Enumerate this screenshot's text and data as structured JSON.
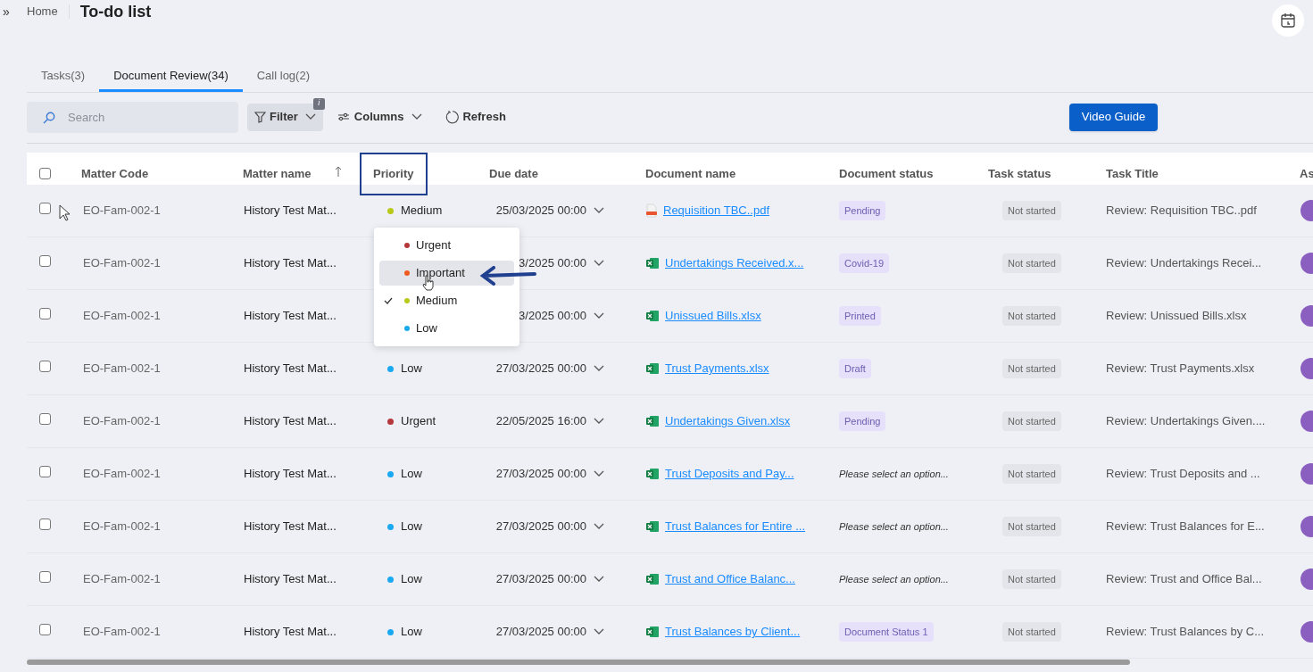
{
  "breadcrumb": {
    "home": "Home",
    "title": "To-do list",
    "expand": "»"
  },
  "tabs": [
    {
      "label": "Tasks(3)",
      "selected": false
    },
    {
      "label": "Document Review(34)",
      "selected": true
    },
    {
      "label": "Call log(2)",
      "selected": false
    }
  ],
  "toolbar": {
    "search": {
      "placeholder": "Search"
    },
    "filter": {
      "label": "Filter",
      "badge": "i"
    },
    "columns": "Columns",
    "refresh": "Refresh",
    "video_guide": "Video Guide"
  },
  "table": {
    "select_all_checked": false,
    "columns": [
      {
        "label": "Matter Code",
        "sorted": false,
        "highlighted": false
      },
      {
        "label": "Matter name",
        "sorted": true,
        "highlighted": false
      },
      {
        "label": "Priority",
        "sorted": false,
        "highlighted": true
      },
      {
        "label": "Due date",
        "sorted": false,
        "highlighted": false
      },
      {
        "label": "Document name",
        "sorted": false,
        "highlighted": false
      },
      {
        "label": "Document status",
        "sorted": false,
        "highlighted": false
      },
      {
        "label": "Task status",
        "sorted": false,
        "highlighted": false
      },
      {
        "label": "Task Title",
        "sorted": false,
        "highlighted": false
      },
      {
        "label": "As",
        "sorted": false,
        "highlighted": false
      }
    ],
    "rows": [
      {
        "checked": false,
        "matter_code": "EO-Fam-002-1",
        "matter_name": "History Test Mat...",
        "priority": {
          "label": "Medium",
          "color": "#b8c91a"
        },
        "due": "25/03/2025 00:00",
        "document": {
          "name": "Requisition TBC..pdf",
          "kind": "pdf"
        },
        "doc_status": {
          "kind": "tag",
          "text": "Pending"
        },
        "task_status": "Not started",
        "task_title": "Review: Requisition TBC..pdf"
      },
      {
        "checked": false,
        "matter_code": "EO-Fam-002-1",
        "matter_name": "History Test Mat...",
        "due": "3/2025 00:00",
        "document": {
          "name": "Undertakings Received.x...",
          "kind": "xlsx"
        },
        "doc_status": {
          "kind": "tag",
          "text": "Covid-19"
        },
        "task_status": "Not started",
        "task_title": "Review: Undertakings Recei..."
      },
      {
        "checked": false,
        "matter_code": "EO-Fam-002-1",
        "matter_name": "History Test Mat...",
        "due": "3/2025 00:00",
        "document": {
          "name": "Unissued Bills.xlsx",
          "kind": "xlsx"
        },
        "doc_status": {
          "kind": "tag",
          "text": "Printed"
        },
        "task_status": "Not started",
        "task_title": "Review: Unissued Bills.xlsx"
      },
      {
        "checked": false,
        "matter_code": "EO-Fam-002-1",
        "matter_name": "History Test Mat...",
        "priority": {
          "label": "Low",
          "color": "#1aa9f0"
        },
        "due": "27/03/2025 00:00",
        "document": {
          "name": "Trust Payments.xlsx",
          "kind": "xlsx"
        },
        "doc_status": {
          "kind": "tag",
          "text": "Draft"
        },
        "task_status": "Not started",
        "task_title": "Review: Trust Payments.xlsx"
      },
      {
        "checked": false,
        "matter_code": "EO-Fam-002-1",
        "matter_name": "History Test Mat...",
        "priority": {
          "label": "Urgent",
          "color": "#b5373b"
        },
        "due": "22/05/2025 16:00",
        "document": {
          "name": "Undertakings Given.xlsx",
          "kind": "xlsx"
        },
        "doc_status": {
          "kind": "tag",
          "text": "Pending"
        },
        "task_status": "Not started",
        "task_title": "Review: Undertakings Given...."
      },
      {
        "checked": false,
        "matter_code": "EO-Fam-002-1",
        "matter_name": "History Test Mat...",
        "priority": {
          "label": "Low",
          "color": "#1aa9f0"
        },
        "due": "27/03/2025 00:00",
        "document": {
          "name": "Trust Deposits and Pay...",
          "kind": "xlsx"
        },
        "doc_status": {
          "kind": "placeholder",
          "text": "Please select an option..."
        },
        "task_status": "Not started",
        "task_title": "Review: Trust Deposits and ..."
      },
      {
        "checked": false,
        "matter_code": "EO-Fam-002-1",
        "matter_name": "History Test Mat...",
        "priority": {
          "label": "Low",
          "color": "#1aa9f0"
        },
        "due": "27/03/2025 00:00",
        "document": {
          "name": "Trust Balances for Entire ...",
          "kind": "xlsx"
        },
        "doc_status": {
          "kind": "placeholder",
          "text": "Please select an option..."
        },
        "task_status": "Not started",
        "task_title": "Review: Trust Balances for E..."
      },
      {
        "checked": false,
        "matter_code": "EO-Fam-002-1",
        "matter_name": "History Test Mat...",
        "priority": {
          "label": "Low",
          "color": "#1aa9f0"
        },
        "due": "27/03/2025 00:00",
        "document": {
          "name": "Trust and Office Balanc...",
          "kind": "xlsx"
        },
        "doc_status": {
          "kind": "placeholder",
          "text": "Please select an option..."
        },
        "task_status": "Not started",
        "task_title": "Review: Trust and Office Bal..."
      },
      {
        "checked": false,
        "matter_code": "EO-Fam-002-1",
        "matter_name": "History Test Mat...",
        "priority": {
          "label": "Low",
          "color": "#1aa9f0"
        },
        "due": "27/03/2025 00:00",
        "document": {
          "name": "Trust Balances by Client...",
          "kind": "xlsx"
        },
        "doc_status": {
          "kind": "tag",
          "text": "Document Status 1"
        },
        "task_status": "Not started",
        "task_title": "Review: Trust Balances by C..."
      }
    ]
  },
  "priority_menu": [
    {
      "label": "Urgent",
      "color": "#b5373b",
      "checked": false,
      "highlighted": false
    },
    {
      "label": "Important",
      "color": "#f05a1e",
      "checked": false,
      "highlighted": true
    },
    {
      "label": "Medium",
      "color": "#b8c91a",
      "checked": true,
      "highlighted": false
    },
    {
      "label": "Low",
      "color": "#1aa9f0",
      "checked": false,
      "highlighted": false
    }
  ]
}
